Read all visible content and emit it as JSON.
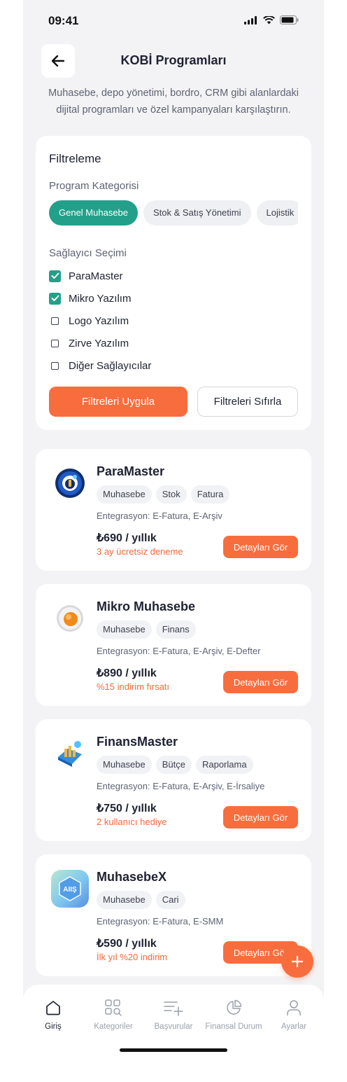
{
  "status_bar": {
    "time": "09:41"
  },
  "header": {
    "title": "KOBİ Programları",
    "subtitle": "Muhasebe, depo yönetimi, bordro, CRM gibi alanlardaki dijital programları ve özel kampanyaları karşılaştırın."
  },
  "filter": {
    "title": "Filtreleme",
    "category_label": "Program Kategorisi",
    "categories": [
      {
        "label": "Genel Muhasebe",
        "active": true
      },
      {
        "label": "Stok & Satış Yönetimi",
        "active": false
      },
      {
        "label": "Lojistik",
        "active": false
      }
    ],
    "provider_label": "Sağlayıcı Seçimi",
    "providers": [
      {
        "label": "ParaMaster",
        "checked": true
      },
      {
        "label": "Mikro Yazılım",
        "checked": true
      },
      {
        "label": "Logo Yazılım",
        "checked": false
      },
      {
        "label": "Zirve Yazılım",
        "checked": false
      },
      {
        "label": "Diğer Sağlayıcılar",
        "checked": false
      }
    ],
    "apply_label": "Filtreleri Uygula",
    "reset_label": "Filtreleri Sıfırla"
  },
  "products": [
    {
      "name": "ParaMaster",
      "tags": [
        "Muhasebe",
        "Stok",
        "Fatura"
      ],
      "integration": "Entegrasyon: E-Fatura, E-Arşiv",
      "price": "₺690 / yıllık",
      "promo": "3 ay ücretsiz deneme",
      "button": "Detayları Gör",
      "logo_icon": "paramaster-logo-icon"
    },
    {
      "name": "Mikro Muhasebe",
      "tags": [
        "Muhasebe",
        "Finans"
      ],
      "integration": "Entegrasyon: E-Fatura, E-Arşiv, E-Defter",
      "price": "₺890 / yıllık",
      "promo": "%15 indirim fırsatı",
      "button": "Detayları Gör",
      "logo_icon": "mikro-logo-icon"
    },
    {
      "name": "FinansMaster",
      "tags": [
        "Muhasebe",
        "Bütçe",
        "Raporlama"
      ],
      "integration": "Entegrasyon: E-Fatura, E-Arşiv, E-İrsaliye",
      "price": "₺750 / yıllık",
      "promo": "2 kullanıcı hediye",
      "button": "Detayları Gör",
      "logo_icon": "finansmaster-logo-icon"
    },
    {
      "name": "MuhasebeX",
      "tags": [
        "Muhasebe",
        "Cari"
      ],
      "integration": "Entegrasyon: E-Fatura, E-SMM",
      "price": "₺590 / yıllık",
      "promo": "İlk yıl %20 indirim",
      "button": "Detayları Gör",
      "logo_icon": "muhasebex-logo-icon",
      "logo_text": "AIIŞ"
    }
  ],
  "tabbar": {
    "items": [
      {
        "label": "Giriş",
        "icon": "home-icon",
        "active": true
      },
      {
        "label": "Kategoriler",
        "icon": "categories-icon",
        "active": false
      },
      {
        "label": "Başvurular",
        "icon": "applications-icon",
        "active": false
      },
      {
        "label": "Finansal Durum",
        "icon": "pie-chart-icon",
        "active": false
      },
      {
        "label": "Ayarlar",
        "icon": "user-icon",
        "active": false
      }
    ]
  },
  "colors": {
    "accent": "#f86d3d",
    "primary": "#22a08a",
    "background": "#f3f3f5",
    "text": "#1e2232"
  }
}
